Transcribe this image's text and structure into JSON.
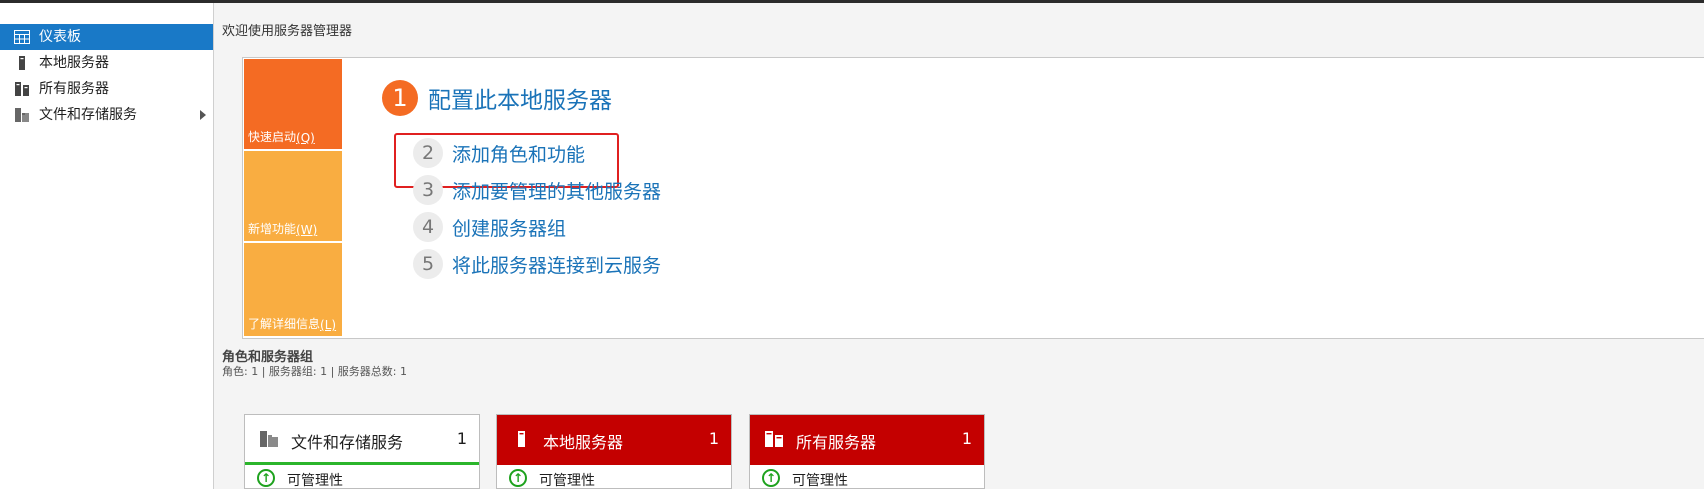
{
  "sidebar": {
    "items": [
      {
        "label": "仪表板",
        "icon": "dashboard-icon",
        "selected": true
      },
      {
        "label": "本地服务器",
        "icon": "server-icon"
      },
      {
        "label": "所有服务器",
        "icon": "servers-icon"
      },
      {
        "label": "文件和存储服务",
        "icon": "file-storage-icon",
        "has_submenu": true
      }
    ]
  },
  "welcome": {
    "title": "欢迎使用服务器管理器",
    "tabs": {
      "quick_start": {
        "label": "快速启动",
        "shortcut": "(Q)"
      },
      "whats_new": {
        "label": "新增功能",
        "shortcut": "(W)"
      },
      "learn_more": {
        "label": "了解详细信息",
        "shortcut": "(L)"
      }
    },
    "steps": [
      {
        "num": "1",
        "label": "配置此本地服务器"
      },
      {
        "num": "2",
        "label": "添加角色和功能"
      },
      {
        "num": "3",
        "label": "添加要管理的其他服务器"
      },
      {
        "num": "4",
        "label": "创建服务器组"
      },
      {
        "num": "5",
        "label": "将此服务器连接到云服务"
      }
    ]
  },
  "roles": {
    "title": "角色和服务器组",
    "summary": "角色: 1 | 服务器组: 1 | 服务器总数: 1",
    "tiles": [
      {
        "name": "文件和存储服务",
        "count": "1",
        "status": "可管理性",
        "style": "white"
      },
      {
        "name": "本地服务器",
        "count": "1",
        "status": "可管理性",
        "style": "red"
      },
      {
        "name": "所有服务器",
        "count": "1",
        "status": "可管理性",
        "style": "red"
      }
    ]
  },
  "colors": {
    "selected": "#1979c7",
    "quick_start": "#f46b23",
    "secondary_tab": "#f9ad41",
    "link": "#1a73b8",
    "tile_alert": "#c40000",
    "ok_green": "#1ea21e"
  }
}
